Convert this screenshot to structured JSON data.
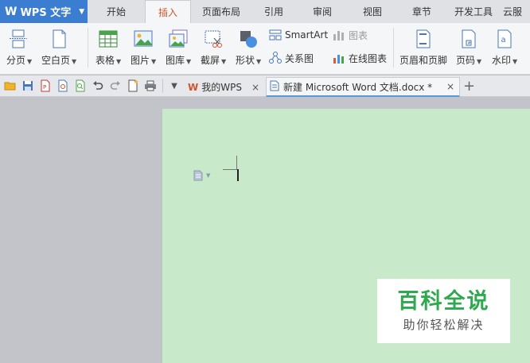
{
  "app": {
    "name": "WPS 文字"
  },
  "menu": {
    "tabs": [
      {
        "label": "开始"
      },
      {
        "label": "插入"
      },
      {
        "label": "页面布局"
      },
      {
        "label": "引用"
      },
      {
        "label": "审阅"
      },
      {
        "label": "视图"
      },
      {
        "label": "章节"
      },
      {
        "label": "开发工具"
      },
      {
        "label": "云服"
      }
    ],
    "active_tab": "插入"
  },
  "ribbon": {
    "page_break": "分页",
    "blank_page": "空白页",
    "table": "表格",
    "picture": "图片",
    "gallery": "图库",
    "screenshot": "截屏",
    "shapes": "形状",
    "smartart": "SmartArt",
    "chart": "图表",
    "relation_chart": "关系图",
    "online_chart": "在线图表",
    "header_footer": "页眉和页脚",
    "page_number": "页码",
    "watermark": "水印"
  },
  "doc_tabs": [
    {
      "label": "我的WPS"
    },
    {
      "label": "新建 Microsoft Word 文档.docx *"
    }
  ],
  "watermark_overlay": {
    "title": "百科全说",
    "subtitle": "助你轻松解决"
  },
  "colors": {
    "app_blue": "#3a7dd1",
    "active_tab_text": "#d2542b",
    "page_bg": "#c8e9ca",
    "wm_green": "#2fa84f"
  }
}
